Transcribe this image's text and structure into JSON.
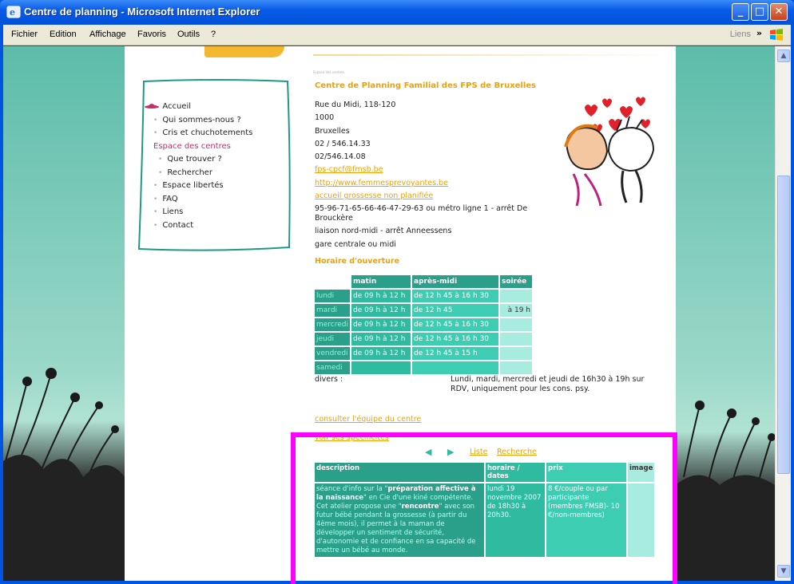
{
  "window": {
    "title": "Centre de planning - Microsoft Internet Explorer",
    "minimize": "_",
    "maximize": "□",
    "close": "✕"
  },
  "menubar": {
    "items": [
      "Fichier",
      "Edition",
      "Affichage",
      "Favoris",
      "Outils",
      "?"
    ],
    "links_label": "Liens",
    "chevron": "»"
  },
  "nav": {
    "items": [
      {
        "label": "Accueil",
        "level": 0
      },
      {
        "label": "Qui sommes-nous ?",
        "level": 0
      },
      {
        "label": "Cris et chuchotements",
        "level": 0
      },
      {
        "label": "Espace des centres",
        "level": 0,
        "active": true
      },
      {
        "label": "Que trouver ?",
        "level": 1
      },
      {
        "label": "Rechercher",
        "level": 1
      },
      {
        "label": "Espace libertés",
        "level": 0
      },
      {
        "label": "FAQ",
        "level": 0
      },
      {
        "label": "Liens",
        "level": 0
      },
      {
        "label": "Contact",
        "level": 0
      }
    ]
  },
  "content": {
    "breadcrumb": "Espace des centres",
    "title": "Centre de Planning Familial des FPS de Bruxelles",
    "address": {
      "street": "Rue du Midi, 118-120",
      "postcode": "1000",
      "city": "Bruxelles",
      "phone": "02 / 546.14.33",
      "fax": "02/546.14.08",
      "email": "fps-cpcf@fmsb.be",
      "website": "http://www.femmesprevoyantes.be",
      "link3": "accueil grossesse non planifiée",
      "transport1": "95-96-71-65-66-46-47-29-63 ou métro ligne 1 - arrêt De Brouckère",
      "transport2": "liaison nord-midi - arrêt Anneessens",
      "transport3": "gare centrale ou midi"
    },
    "hours_title": "Horaire d'ouverture",
    "hours_headers": [
      "matin",
      "après-midi",
      "soirée"
    ],
    "hours_rows": [
      {
        "day": "lundi",
        "matin": "de 09 h à 12 h",
        "apres": "de 12 h 45 à 16 h 30",
        "soiree": ""
      },
      {
        "day": "mardi",
        "matin": "de 09 h à 12 h",
        "apres": "de 12 h 45",
        "soiree": "à 19 h"
      },
      {
        "day": "mercredi",
        "matin": "de 09 h à 12 h",
        "apres": "de 12 h 45 à 16 h 30",
        "soiree": ""
      },
      {
        "day": "jeudi",
        "matin": "de 09 h à 12 h",
        "apres": "de 12 h 45 à 16 h 30",
        "soiree": ""
      },
      {
        "day": "vendredi",
        "matin": "de 09 h à 12 h",
        "apres": "de 12 h 45 à 15 h",
        "soiree": ""
      },
      {
        "day": "samedi",
        "matin": "",
        "apres": "",
        "soiree": ""
      }
    ],
    "divers_label": "divers :",
    "divers_text": "Lundi, mardi, mercredi et jeudi de 16h30 à 19h sur RDV, uniquement pour les cons. psy.",
    "link_team": "consulter l'équipe du centre",
    "link_spec": "voir ses spécificités",
    "pager": {
      "prev": "◀",
      "next": "▶",
      "list": "Liste",
      "search": "Recherche"
    },
    "events_headers": [
      "description",
      "horaire / dates",
      "prix",
      "image"
    ],
    "event": {
      "desc_pre": "séance d'info sur la \"",
      "desc_bold1": "préparation affective à la naissance",
      "desc_mid": "\" en Cie d'une kiné compétente.",
      "desc_line2_pre": "Cet atelier propose une \"",
      "desc_bold2": "rencontre",
      "desc_line2_post": "\" avec son futur bébé pendant la grossesse (à partir du 4ème mois), il permet à la maman de développer un sentiment de sécurité, d'autonomie et de confiance en sa capacité de mettre un bébé au monde.",
      "dates": "lundi 19 novembre 2007 de 18h30 à 20h30.",
      "price": "8 €/couple ou par participante (membres FMSB)- 10 €/non-membres)"
    }
  },
  "scrollbar": {
    "up": "▲",
    "down": "▼"
  }
}
